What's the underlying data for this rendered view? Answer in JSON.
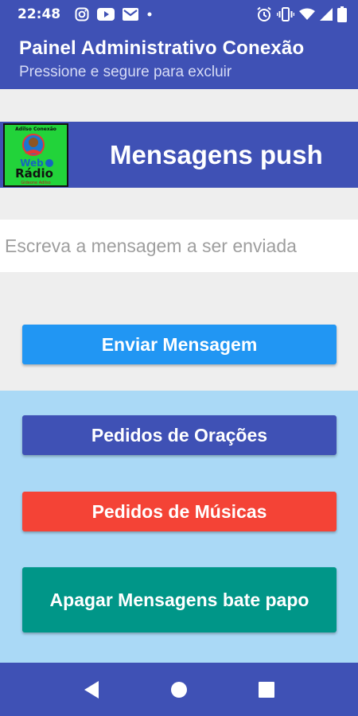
{
  "status_bar": {
    "time": "22:48",
    "left_icons": [
      "instagram-icon",
      "youtube-icon",
      "gmail-icon",
      "dot-icon"
    ],
    "right_icons": [
      "alarm-icon",
      "vibrate-icon",
      "wifi-icon",
      "signal-icon",
      "battery-icon"
    ]
  },
  "app_bar": {
    "title": "Painel Administrativo Conexão",
    "subtitle": "Pressione e segure para excluir"
  },
  "header": {
    "logo_text": [
      "Adilso Conexão",
      "Web",
      "Rádio",
      "Gideone Adilso"
    ],
    "title": "Mensagens push"
  },
  "message": {
    "placeholder": "Escreva a mensagem a ser enviada",
    "value": ""
  },
  "buttons": {
    "send": "Enviar Mensagem",
    "prayers": "Pedidos de Orações",
    "music": "Pedidos de Músicas",
    "delete_chat": "Apagar Mensagens bate papo"
  },
  "colors": {
    "primary": "#3f51b5",
    "send": "#2196f3",
    "music": "#f44336",
    "delete": "#009688",
    "panel": "#aad9f6"
  },
  "nav_bar": {
    "icons": [
      "back-icon",
      "home-icon",
      "recents-icon"
    ]
  }
}
